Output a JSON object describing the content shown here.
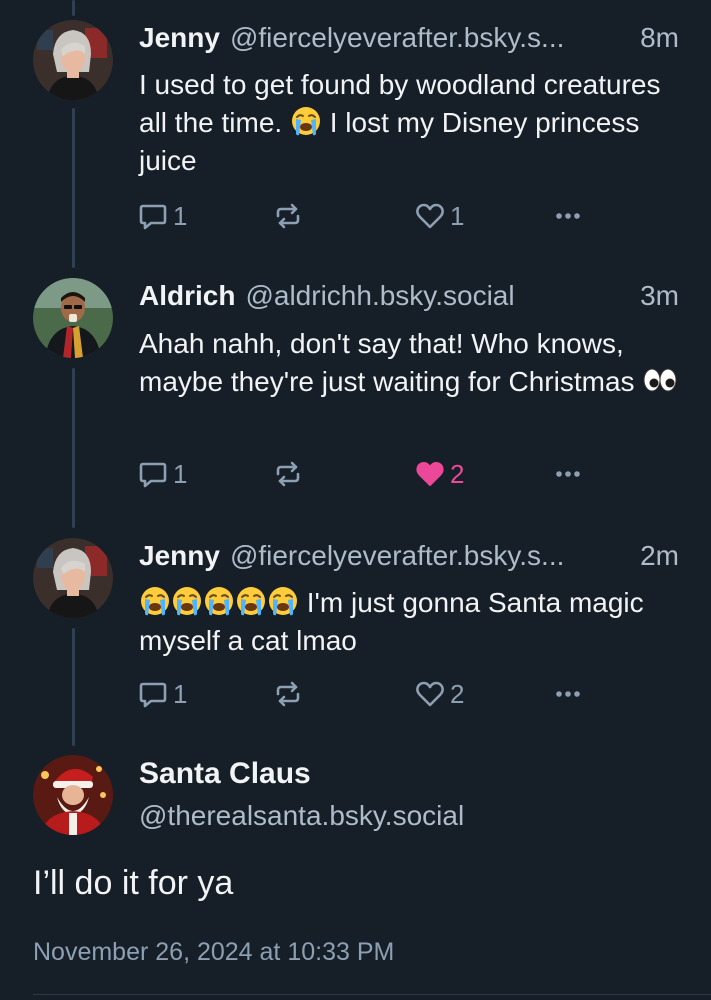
{
  "colors": {
    "background": "#161e27",
    "text_primary": "#f1f3f5",
    "text_secondary": "#aebbc9",
    "icon_muted": "#8d9fb2",
    "like_active": "#ec4899",
    "thread_line": "#2e4052"
  },
  "posts": [
    {
      "name": "Jenny",
      "handle": "@fiercelyeverafter.bsky.s...",
      "time": "8m",
      "text_before": "I used to get found by woodland creatures all the time.",
      "emoji": "crying-face",
      "text_after": "I lost my Disney princess juice",
      "replies": "1",
      "reposts": "",
      "likes": "1",
      "liked": false
    },
    {
      "name": "Aldrich",
      "handle": "@aldrichh.bsky.social",
      "time": "3m",
      "text_before": "Ahah nahh, don't say that! Who knows, maybe they're just waiting for Christmas",
      "emoji": "eyes",
      "replies": "1",
      "reposts": "",
      "likes": "2",
      "liked": true
    },
    {
      "name": "Jenny",
      "handle": "@fiercelyeverafter.bsky.s...",
      "time": "2m",
      "emoji": "crying-face x5",
      "text_after": "I'm just gonna Santa magic myself a cat lmao",
      "replies": "1",
      "reposts": "",
      "likes": "2",
      "liked": false
    }
  ],
  "main_post": {
    "name": "Santa Claus",
    "handle": "@therealsanta.bsky.social",
    "text": "I’ll do it for ya",
    "timestamp": "November 26, 2024 at 10:33 PM"
  },
  "icons": {
    "reply": "reply-bubble-icon",
    "repost": "repost-arrows-icon",
    "like": "heart-icon",
    "more": "more-dots-icon"
  }
}
